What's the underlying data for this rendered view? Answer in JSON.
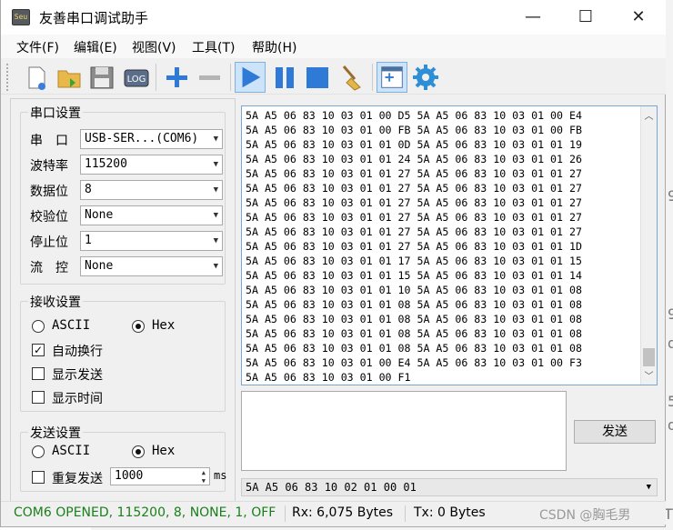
{
  "window": {
    "title": "友善串口调试助手",
    "app_icon_text": "Seu",
    "minimize": "—",
    "maximize": "☐",
    "close": "✕"
  },
  "menu": [
    "文件(F)",
    "编辑(E)",
    "视图(V)",
    "工具(T)",
    "帮助(H)"
  ],
  "toolbar": {
    "log_label": "LOG",
    "icons": [
      "new-file-icon",
      "open-folder-icon",
      "save-disk-icon",
      "log-icon",
      "add-icon",
      "remove-icon",
      "play-icon",
      "pause-icon",
      "stop-icon",
      "broom-icon",
      "window-icon",
      "gear-icon"
    ]
  },
  "serial_settings": {
    "title": "串口设置",
    "port_label": "串　口",
    "port_value": "USB-SER...(COM6)",
    "baud_label": "波特率",
    "baud_value": "115200",
    "databits_label": "数据位",
    "databits_value": "8",
    "parity_label": "校验位",
    "parity_value": "None",
    "stopbits_label": "停止位",
    "stopbits_value": "1",
    "flow_label": "流　控",
    "flow_value": "None"
  },
  "receive_settings": {
    "title": "接收设置",
    "ascii_label": "ASCII",
    "hex_label": "Hex",
    "mode": "Hex",
    "wrap_label": "自动换行",
    "wrap_checked": true,
    "show_send_label": "显示发送",
    "show_send_checked": false,
    "show_time_label": "显示时间",
    "show_time_checked": false
  },
  "send_settings": {
    "title": "发送设置",
    "ascii_label": "ASCII",
    "hex_label": "Hex",
    "mode": "Hex",
    "repeat_label": "重复发送",
    "repeat_checked": false,
    "interval_value": "1000",
    "interval_unit": "ms"
  },
  "receive_data": "5A A5 06 83 10 03 01 00 D5 5A A5 06 83 10 03 01 00 E4\n5A A5 06 83 10 03 01 00 FB 5A A5 06 83 10 03 01 00 FB\n5A A5 06 83 10 03 01 01 0D 5A A5 06 83 10 03 01 01 19\n5A A5 06 83 10 03 01 01 24 5A A5 06 83 10 03 01 01 26\n5A A5 06 83 10 03 01 01 27 5A A5 06 83 10 03 01 01 27\n5A A5 06 83 10 03 01 01 27 5A A5 06 83 10 03 01 01 27\n5A A5 06 83 10 03 01 01 27 5A A5 06 83 10 03 01 01 27\n5A A5 06 83 10 03 01 01 27 5A A5 06 83 10 03 01 01 27\n5A A5 06 83 10 03 01 01 27 5A A5 06 83 10 03 01 01 27\n5A A5 06 83 10 03 01 01 27 5A A5 06 83 10 03 01 01 1D\n5A A5 06 83 10 03 01 01 17 5A A5 06 83 10 03 01 01 15\n5A A5 06 83 10 03 01 01 15 5A A5 06 83 10 03 01 01 14\n5A A5 06 83 10 03 01 01 10 5A A5 06 83 10 03 01 01 08\n5A A5 06 83 10 03 01 01 08 5A A5 06 83 10 03 01 01 08\n5A A5 06 83 10 03 01 01 08 5A A5 06 83 10 03 01 01 08\n5A A5 06 83 10 03 01 01 08 5A A5 06 83 10 03 01 01 08\n5A A5 06 83 10 03 01 01 08 5A A5 06 83 10 03 01 01 08\n5A A5 06 83 10 03 01 00 E4 5A A5 06 83 10 03 01 00 F3\n5A A5 06 83 10 03 01 00 F1",
  "send_button": "发送",
  "send_history_value": "5A A5 06 83 10 02 01 00 01",
  "status": {
    "connection": "COM6 OPENED, 115200, 8, NONE, 1, OFF",
    "rx": "Rx: 6,075 Bytes",
    "tx": "Tx: 0 Bytes"
  },
  "watermark": "CSDN @胸毛男",
  "background_fragments": [
    "9",
    "9",
    "d",
    "5",
    "d",
    "T"
  ],
  "colors": {
    "status_green": "#1a7f1a",
    "accent_blue": "#2a6fc9"
  }
}
